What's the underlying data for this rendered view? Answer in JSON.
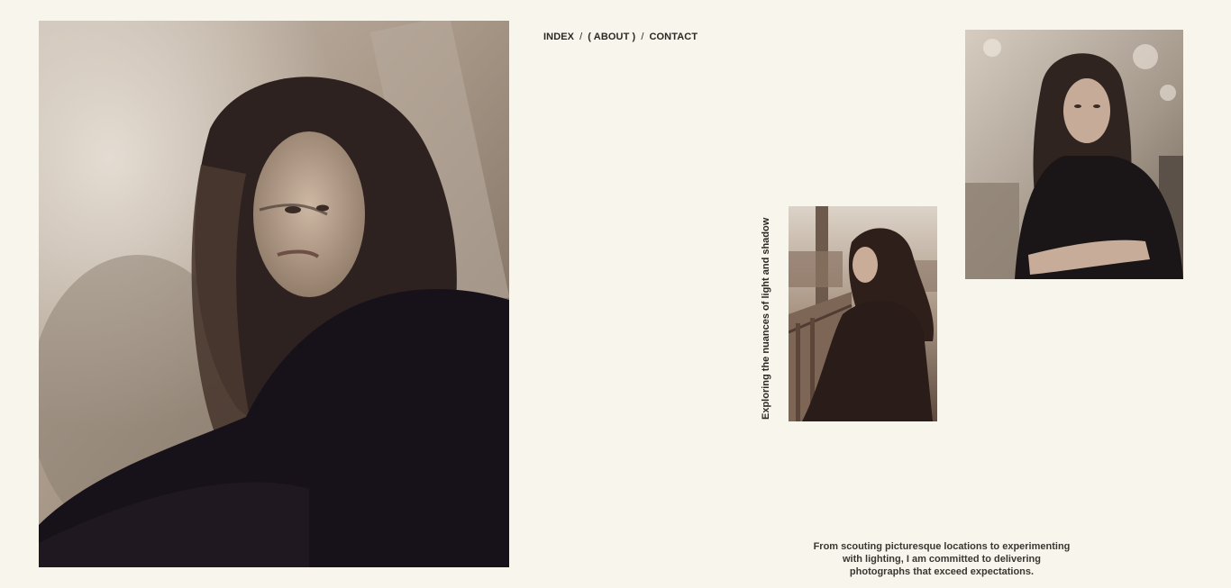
{
  "nav": {
    "items": [
      {
        "label": "INDEX"
      },
      {
        "label": "( ABOUT )"
      },
      {
        "label": "CONTACT"
      }
    ],
    "separator": "/"
  },
  "caption": {
    "vertical": "Exploring the nuances of light and shadow"
  },
  "statement": {
    "text": "From scouting picturesque locations to experimenting with lighting, I am committed to delivering photographs that exceed expectations."
  },
  "colors": {
    "background": "#f8f6ec",
    "text": "#2c2824"
  }
}
